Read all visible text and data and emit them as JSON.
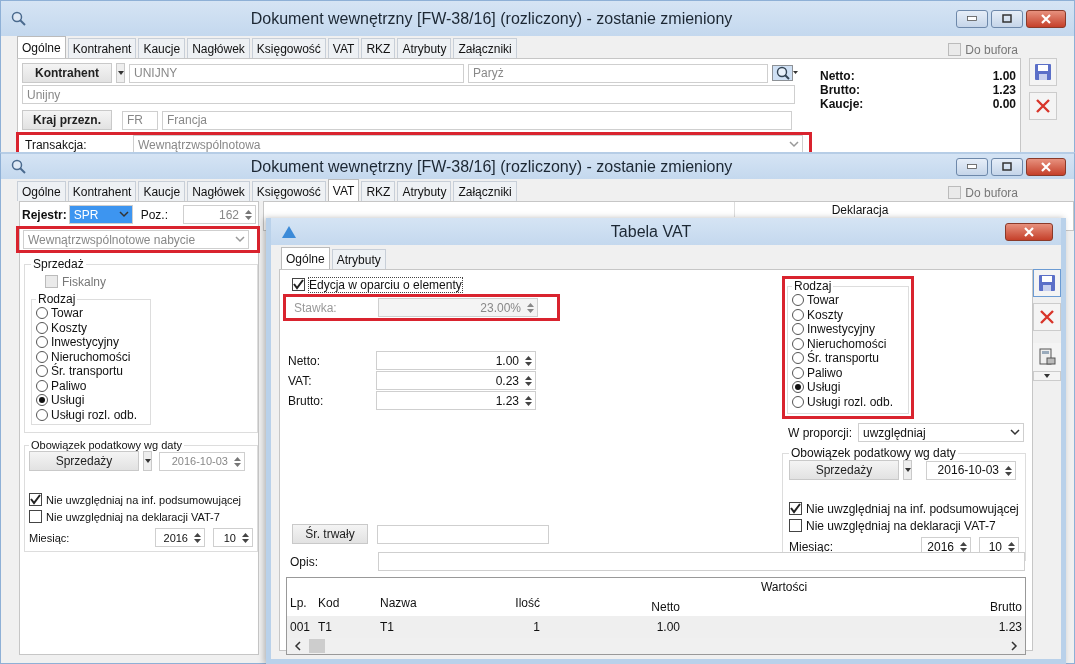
{
  "top_window": {
    "title": "Dokument wewnętrzny [FW-38/16] (rozliczony) - zostanie zmieniony",
    "tabs": [
      {
        "label": "Ogólne",
        "selected": true
      },
      {
        "label": "Kontrahent",
        "selected": false
      },
      {
        "label": "Kaucje",
        "selected": false
      },
      {
        "label": "Nagłówek",
        "selected": false
      },
      {
        "label": "Księgowość",
        "selected": false
      },
      {
        "label": "VAT",
        "selected": false
      },
      {
        "label": "RKZ",
        "selected": false
      },
      {
        "label": "Atrybuty",
        "selected": false
      },
      {
        "label": "Załączniki",
        "selected": false
      }
    ],
    "do_bufora": {
      "label": "Do bufora",
      "checked": false
    },
    "kontrahent_button": "Kontrahent",
    "kontrahent_code": "UNIJNY",
    "city": "Paryż",
    "kontrahent_name": "Unijny",
    "country_button": "Kraj przezn.",
    "country_code": "FR",
    "country_name": "Francja",
    "transaction": {
      "label": "Transakcja:",
      "value": "Wewnątrzwspólnotowa",
      "highlighted": true
    },
    "totals": [
      {
        "label": "Netto:",
        "value": "1.00"
      },
      {
        "label": "Brutto:",
        "value": "1.23"
      },
      {
        "label": "Kaucje:",
        "value": "0.00"
      }
    ]
  },
  "vat_window": {
    "title": "Dokument wewnętrzny [FW-38/16] (rozliczony) - zostanie zmieniony",
    "tabs": [
      {
        "label": "Ogólne",
        "selected": false
      },
      {
        "label": "Kontrahent",
        "selected": false
      },
      {
        "label": "Kaucje",
        "selected": false
      },
      {
        "label": "Nagłówek",
        "selected": false
      },
      {
        "label": "Księgowość",
        "selected": false
      },
      {
        "label": "VAT",
        "selected": true
      },
      {
        "label": "RKZ",
        "selected": false
      },
      {
        "label": "Atrybuty",
        "selected": false
      },
      {
        "label": "Załączniki",
        "selected": false
      }
    ],
    "do_bufora": {
      "label": "Do bufora",
      "checked": false
    },
    "rejestr": {
      "label": "Rejestr:",
      "value": "SPR"
    },
    "poz": {
      "label": "Poz.:",
      "value": "162"
    },
    "transaction_type": {
      "value": "Wewnątrzwspólnotowe nabycie",
      "highlighted": true
    },
    "sprzedaz": {
      "title": "Sprzedaż",
      "fiskalny": {
        "label": "Fiskalny",
        "checked": false,
        "disabled": true
      },
      "rodzaj": {
        "title": "Rodzaj",
        "options": [
          {
            "label": "Towar",
            "selected": false
          },
          {
            "label": "Koszty",
            "selected": false
          },
          {
            "label": "Inwestycyjny",
            "selected": false
          },
          {
            "label": "Nieruchomości",
            "selected": false
          },
          {
            "label": "Śr. transportu",
            "selected": false
          },
          {
            "label": "Paliwo",
            "selected": false
          },
          {
            "label": "Usługi",
            "selected": true
          },
          {
            "label": "Usługi rozl. odb.",
            "selected": false
          }
        ]
      }
    },
    "obowiazek": {
      "title": "Obowiązek podatkowy wg daty",
      "button": "Sprzedaży",
      "date": "2016-10-03",
      "checkboxes": [
        {
          "label": "Nie uwzględniaj na inf. podsumowującej",
          "checked": true
        },
        {
          "label": "Nie uwzględniaj na deklaracji VAT-7",
          "checked": false
        }
      ],
      "month_label": "Miesiąc:",
      "year": "2016",
      "month": "10"
    },
    "table_header": "Deklaracja"
  },
  "vat_table_window": {
    "title": "Tabela VAT",
    "tabs": [
      {
        "label": "Ogólne",
        "selected": true
      },
      {
        "label": "Atrybuty",
        "selected": false
      }
    ],
    "edit_checkbox": {
      "label": "Edycja w oparciu o elementy",
      "checked": true
    },
    "stawka": {
      "label": "Stawka:",
      "value": "23.00%",
      "disabled": true,
      "highlighted": true
    },
    "amounts": [
      {
        "label": "Netto:",
        "value": "1.00"
      },
      {
        "label": "VAT:",
        "value": "0.23"
      },
      {
        "label": "Brutto:",
        "value": "1.23"
      }
    ],
    "rodzaj": {
      "title": "Rodzaj",
      "highlighted": true,
      "options": [
        {
          "label": "Towar",
          "selected": false
        },
        {
          "label": "Koszty",
          "selected": false
        },
        {
          "label": "Inwestycyjny",
          "selected": false
        },
        {
          "label": "Nieruchomości",
          "selected": false
        },
        {
          "label": "Śr. transportu",
          "selected": false
        },
        {
          "label": "Paliwo",
          "selected": false
        },
        {
          "label": "Usługi",
          "selected": true
        },
        {
          "label": "Usługi rozl. odb.",
          "selected": false
        }
      ]
    },
    "proporcja": {
      "label": "W proporcji:",
      "value": "uwzględniaj"
    },
    "obowiazek": {
      "title": "Obowiązek podatkowy wg daty",
      "button": "Sprzedaży",
      "date": "2016-10-03",
      "checkboxes": [
        {
          "label": "Nie uwzględniaj na inf. podsumowującej",
          "checked": true
        },
        {
          "label": "Nie uwzględniaj na deklaracji VAT-7",
          "checked": false
        }
      ],
      "month_label": "Miesiąc:",
      "year": "2016",
      "month": "10"
    },
    "sr_trwaly": "Śr. trwały",
    "opis_label": "Opis:",
    "table": {
      "columns": [
        "Lp.",
        "Kod",
        "Nazwa",
        "Ilość"
      ],
      "group_header": "Wartości",
      "value_columns": [
        "Netto",
        "Brutto"
      ],
      "rows": [
        {
          "lp": "001",
          "kod": "T1",
          "nazwa": "T1",
          "ilosc": "1",
          "netto": "1.00",
          "brutto": "1.23"
        }
      ]
    }
  }
}
